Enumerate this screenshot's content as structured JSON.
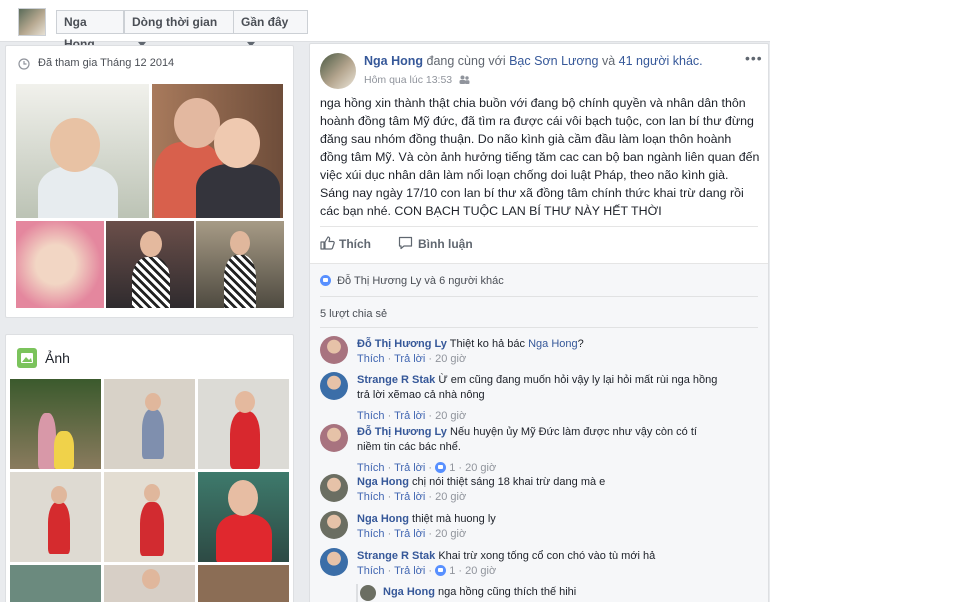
{
  "topbar": {
    "name_button": "Nga Hong",
    "timeline_button": "Dòng thời gian",
    "recent_button": "Gần đây"
  },
  "intro": {
    "joined": "Đã tham gia Tháng 12 2014"
  },
  "photos_section": {
    "title": "Ảnh"
  },
  "post": {
    "author": "Nga Hong",
    "with_text": "đang cùng với",
    "tagged": "Bạc Sơn Lương",
    "and_text": "và",
    "others": "41 người khác.",
    "time": "Hôm qua lúc 13:53",
    "text": "nga hồng xin thành thật chia buồn với đang bộ chính quyền và nhân dân thôn hoành đồng tâm Mỹ đức, đã tìm ra được cái vôi bạch tuộc, con lan bí thư đừng đăng sau nhóm đồng thuận. Do não kình già cầm đầu làm loạn thôn hoành đồng tâm Mỹ. Và còn ảnh hưởng tiếng tăm cac can bộ ban ngành liên quan đến việc xúi dục nhân dân làm nổi loạn chống doi luật Pháp, theo não kình già. Sáng nay ngày 17/10 con lan bí thư xã đồng tâm chính thức khai trừ dang rồi các bạn nhé. CON BẠCH TUỘC LAN BÍ THƯ NÀY HẾT THỜI",
    "like_label": "Thích",
    "comment_label": "Bình luận",
    "reactions": "Đỗ Thị Hương Ly và 6 người khác",
    "shares": "5 lượt chia sẻ"
  },
  "comments": [
    {
      "name": "Đỗ Thị Hương Ly",
      "text": "Thiệt ko hả bác",
      "tag": "Nga Hong",
      "after": "?",
      "like": "Thích",
      "reply": "Trả lời",
      "likes": "",
      "time": "20 giờ",
      "avatar": "#a8737f"
    },
    {
      "name": "Strange R Stak",
      "text": "Ừ em cũng đang muốn hỏi vậy ly lại hỏi mất rùi nga hồng trả lời xẽmao cả nhà nông",
      "tag": "",
      "after": "",
      "like": "Thích",
      "reply": "Trả lời",
      "likes": "",
      "time": "20 giờ",
      "avatar": "#3b6ea8"
    },
    {
      "name": "Đỗ Thị Hương Ly",
      "text": "Nếu huyện ủy Mỹ Đức làm được như vậy còn có tí niềm tin các bác nhể.",
      "tag": "",
      "after": "",
      "like": "Thích",
      "reply": "Trả lời",
      "likes": "1",
      "time": "20 giờ",
      "avatar": "#a8737f"
    },
    {
      "name": "Nga Hong",
      "text": "chị nói thiệt sáng 18 khai trừ dang mà e",
      "tag": "",
      "after": "",
      "like": "Thích",
      "reply": "Trả lời",
      "likes": "",
      "time": "20 giờ",
      "avatar": "#6b6e62"
    },
    {
      "name": "Nga Hong",
      "text": "thiệt mà huong ly",
      "tag": "",
      "after": "",
      "like": "Thích",
      "reply": "Trả lời",
      "likes": "",
      "time": "20 giờ",
      "avatar": "#6b6e62"
    },
    {
      "name": "Strange R Stak",
      "text": "Khai trừ xong tống cổ con chó vào tù mới hả",
      "tag": "",
      "after": "",
      "like": "Thích",
      "reply": "Trả lời",
      "likes": "1",
      "time": "20 giờ",
      "avatar": "#3b6ea8"
    }
  ],
  "reply": {
    "name": "Nga Hong",
    "text": "nga hồng cũng thích thế hihi"
  },
  "colors": {
    "link": "#365899",
    "accent": "#4267b2",
    "muted": "#90949c"
  }
}
